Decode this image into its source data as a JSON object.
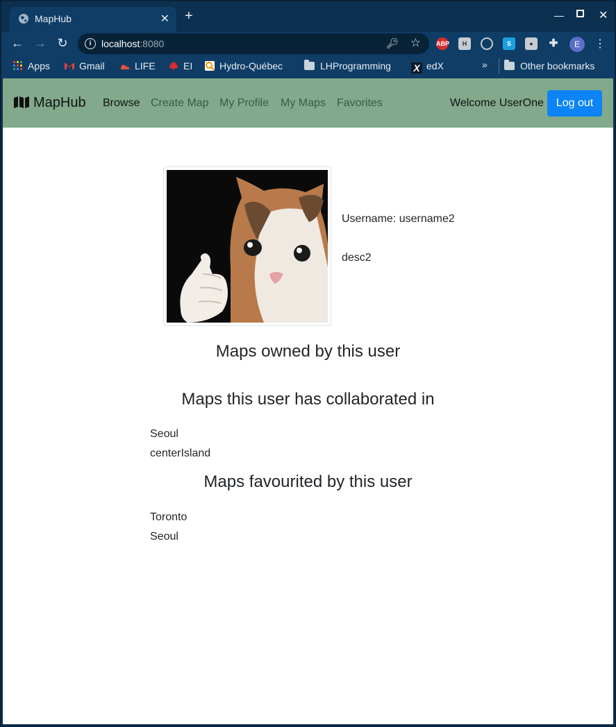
{
  "browser": {
    "tab_title": "MapHub",
    "url_host": "localhost",
    "url_port": ":8080",
    "bookmarks": [
      "Apps",
      "Gmail",
      "LIFE",
      "EI",
      "Hydro-Québec",
      "LHProgramming",
      "edX"
    ],
    "other_bookmarks": "Other bookmarks",
    "profile_initial": "E"
  },
  "navbar": {
    "brand": "MapHub",
    "links": [
      "Browse",
      "Create Map",
      "My Profile",
      "My Maps",
      "Favorites"
    ],
    "welcome": "Welcome UserOne",
    "logout": "Log out",
    "bg_color": "#82a98b",
    "logout_color": "#0d84f5"
  },
  "profile": {
    "username": "Username: username2",
    "description": "desc2"
  },
  "sections": {
    "owned_title": "Maps owned by this user",
    "collab_title": "Maps this user has collaborated in",
    "collab_maps": [
      "Seoul",
      "centerIsland"
    ],
    "fav_title": "Maps favourited by this user",
    "fav_maps": [
      "Toronto",
      "Seoul"
    ]
  }
}
